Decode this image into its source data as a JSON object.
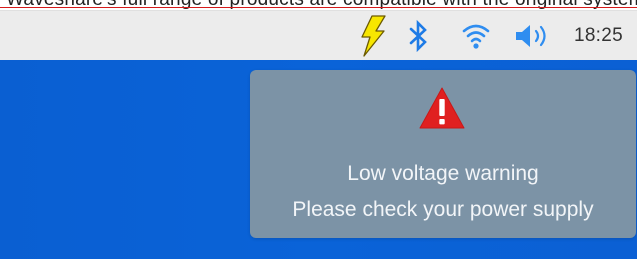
{
  "top_clip": {
    "text": "Waveshare's full range of products are compatible with the original system of Raspberry Pi, featuring high-quality and low-power-consumption design, including displays, sensors, and other accessories."
  },
  "tray": {
    "icons": {
      "lightning": "lightning-icon",
      "bluetooth": "bluetooth-icon",
      "wifi": "wifi-icon",
      "volume": "volume-icon"
    },
    "clock": "18:25",
    "colors": {
      "lightning_fill": "#f7e600",
      "lightning_outline": "#6b5a00",
      "bluetooth": "#1e7be6",
      "wifi": "#2f8df0",
      "volume": "#2f8df0"
    }
  },
  "desktop": {
    "background": "#0a60d4"
  },
  "notification": {
    "icon": "warning-triangle-icon",
    "line1": "Low voltage warning",
    "line2": "Please check your power supply",
    "colors": {
      "background": "#7c93a6",
      "triangle": "#e02020",
      "text": "#f2f5f8"
    }
  }
}
